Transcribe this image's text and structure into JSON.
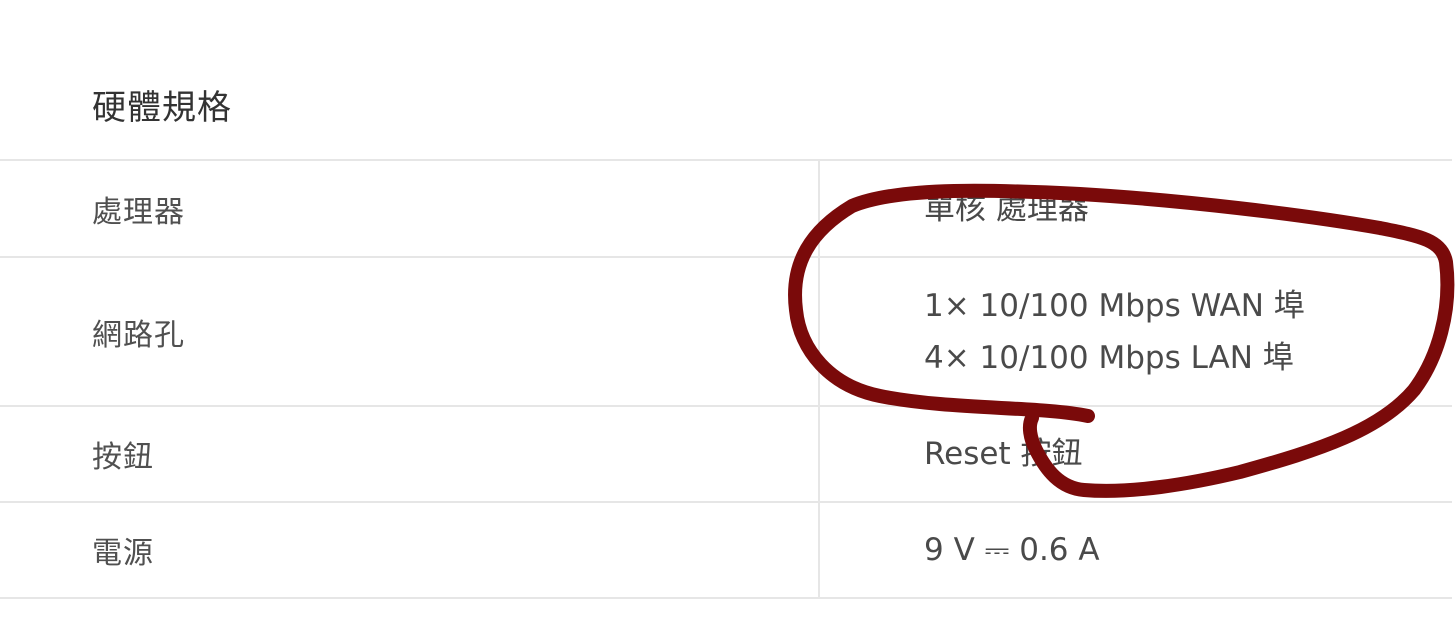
{
  "section": {
    "title": "硬體規格"
  },
  "specs": [
    {
      "label": "處理器",
      "values": [
        "單核 處理器"
      ]
    },
    {
      "label": "網路孔",
      "values": [
        "1× 10/100 Mbps WAN 埠",
        "4× 10/100 Mbps LAN 埠"
      ]
    },
    {
      "label": "按鈕",
      "values": [
        "Reset 按鈕"
      ]
    },
    {
      "label": "電源",
      "values": [
        "9 V ⎓ 0.6 A"
      ]
    }
  ],
  "annotation": {
    "color": "#7a0a0a",
    "shape": "hand-drawn-circle"
  }
}
